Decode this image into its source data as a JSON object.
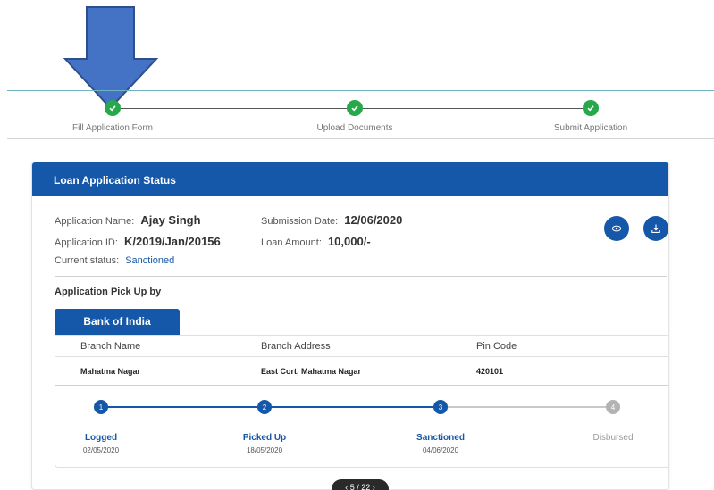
{
  "steps_top": [
    {
      "label": "Fill Application Form"
    },
    {
      "label": "Upload Documents"
    },
    {
      "label": "Submit Application"
    }
  ],
  "card": {
    "title": "Loan Application Status",
    "application_name_label": "Application Name:",
    "application_name": "Ajay Singh",
    "application_id_label": "Application ID:",
    "application_id": "K/2019/Jan/20156",
    "current_status_label": "Current status:",
    "current_status": "Sanctioned",
    "submission_date_label": "Submission Date:",
    "submission_date": "12/06/2020",
    "loan_amount_label": "Loan Amount:",
    "loan_amount": "10,000/-",
    "pickup_title": "Application Pick Up by",
    "bank_tab": "Bank of India",
    "table": {
      "headers": [
        "Branch Name",
        "Branch Address",
        "Pin Code"
      ],
      "row": [
        "Mahatma Nagar",
        "East Cort, Mahatma Nagar",
        "420101"
      ]
    },
    "tracker": [
      {
        "num": "1",
        "label": "Logged",
        "date": "02/05/2020"
      },
      {
        "num": "2",
        "label": "Picked Up",
        "date": "18/05/2020"
      },
      {
        "num": "3",
        "label": "Sanctioned",
        "date": "04/06/2020"
      },
      {
        "num": "4",
        "label": "Disbursed",
        "date": ""
      }
    ]
  },
  "pager": "‹  5 / 22  ›",
  "colors": {
    "primary": "#1557a8",
    "success": "#27a84a",
    "inactive": "#b3b3b3",
    "arrow": "#4472c4"
  },
  "icons": {
    "view": "eye-icon",
    "download": "download-icon",
    "step_done": "check-icon"
  }
}
